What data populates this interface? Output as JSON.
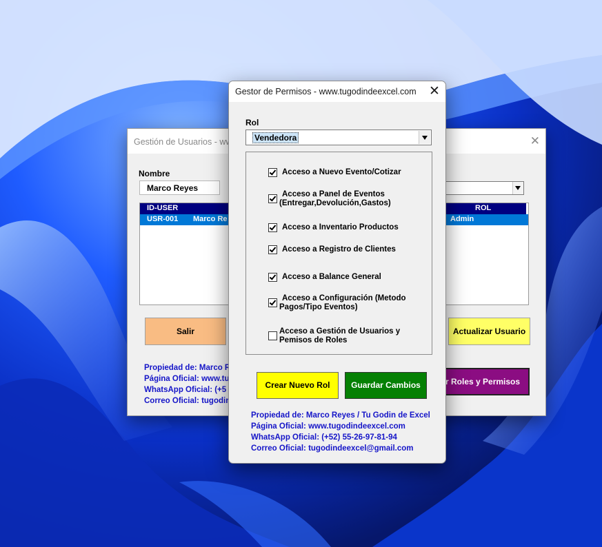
{
  "background_window": {
    "title": "Gestión de Usuarios - www",
    "nombre_label": "Nombre",
    "nombre_value": "Marco Reyes",
    "table": {
      "headers": [
        "ID-USER",
        "ROL"
      ],
      "rows": [
        [
          "USR-001",
          "Marco Re",
          "Admin"
        ]
      ]
    },
    "salir_label": "Salir",
    "actualizar_label": "Actualizar Usuario",
    "roles_label": "r Roles y Permisos",
    "info": [
      "Propiedad de: Marco R",
      "Página Oficial: www.tu",
      "WhatsApp Oficial: (+5",
      "Correo Oficial: tugodin"
    ]
  },
  "dialog": {
    "title": "Gestor de Permisos - www.tugodindeexcel.com",
    "rol_label": "Rol",
    "rol_value": "Vendedora",
    "permissions": [
      {
        "line1": "Acceso a Nuevo Evento/Cotizar",
        "line2": "",
        "checked": true
      },
      {
        "line1": "Acceso a Panel de Eventos",
        "line2": "(Entregar,Devolución,Gastos)",
        "checked": true
      },
      {
        "line1": "Acceso a Inventario Productos",
        "line2": "",
        "checked": true
      },
      {
        "line1": "Acceso a Registro de Clientes",
        "line2": "",
        "checked": true
      },
      {
        "line1": "Acceso a Balance General",
        "line2": "",
        "checked": true
      },
      {
        "line1": "Acceso a Configuración (Metodo",
        "line2": "Pagos/Tipo Eventos)",
        "checked": true
      },
      {
        "line1": "Acceso a Gestión de Usuarios y",
        "line2": "Pemisos de Roles",
        "checked": false
      }
    ],
    "crear_label": "Crear Nuevo Rol",
    "guardar_label": "Guardar Cambios",
    "info": [
      "Propiedad de: Marco Reyes / Tu Godin de Excel",
      "Página Oficial: www.tugodindeexcel.com",
      "WhatsApp Oficial: (+52) 55-26-97-81-94",
      "Correo Oficial: tugodindeexcel@gmail.com"
    ]
  },
  "colors": {
    "header_navy": "#000080",
    "selection_blue": "#0078d7",
    "info_text": "#1515c8",
    "btn_crear": "#ffff00",
    "btn_guardar": "#058004",
    "btn_salir": "#f9bc83",
    "btn_actualizar": "#ffff66",
    "btn_roles": "#8b0d82"
  }
}
